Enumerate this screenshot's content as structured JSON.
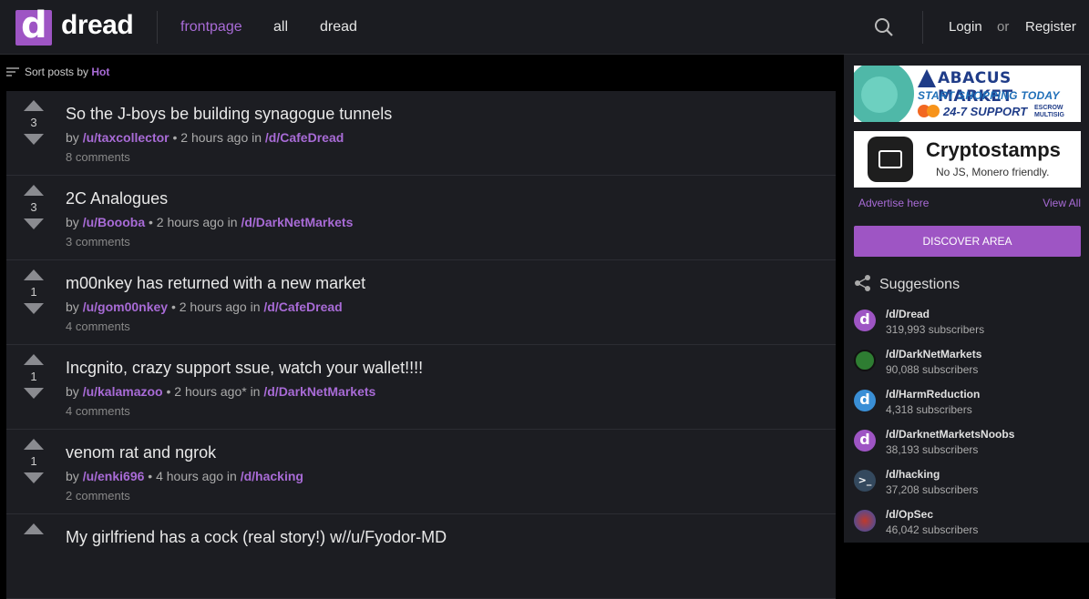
{
  "header": {
    "logo_letter": "d",
    "brand": "dread",
    "nav": [
      "frontpage",
      "all",
      "dread"
    ],
    "login": "Login",
    "or": "or",
    "register": "Register"
  },
  "sort": {
    "prefix": "Sort posts by",
    "value": "Hot"
  },
  "posts": [
    {
      "score": "3",
      "title": "So the J-boys be building synagogue tunnels",
      "by": "by",
      "author": "/u/taxcollector",
      "time": " • 2 hours ago in ",
      "sub": "/d/CafeDread",
      "comments": "8 comments"
    },
    {
      "score": "3",
      "title": "2C Analogues",
      "by": "by",
      "author": "/u/Boooba",
      "time": " • 2 hours ago in ",
      "sub": "/d/DarkNetMarkets",
      "comments": "3 comments"
    },
    {
      "score": "1",
      "title": "m00nkey has returned with a new market",
      "by": "by",
      "author": "/u/gom00nkey",
      "time": " • 2 hours ago in ",
      "sub": "/d/CafeDread",
      "comments": "4 comments"
    },
    {
      "score": "1",
      "title": "Incgnito, crazy support ssue, watch your wallet!!!!",
      "by": "by",
      "author": "/u/kalamazoo",
      "time": " • 2 hours ago* in ",
      "sub": "/d/DarkNetMarkets",
      "comments": "4 comments"
    },
    {
      "score": "1",
      "title": "venom rat and ngrok",
      "by": "by",
      "author": "/u/enki696",
      "time": " • 4 hours ago in ",
      "sub": "/d/hacking",
      "comments": "2 comments"
    },
    {
      "score": "",
      "title": "My girlfriend has a cock (real story!) w//u/Fyodor-MD",
      "by": "",
      "author": "",
      "time": "",
      "sub": "",
      "comments": ""
    }
  ],
  "ads": {
    "abacus_title": "ABACUS MARKET",
    "abacus_line2": "START SHOPPING TODAY",
    "abacus_line3": "24-7 SUPPORT",
    "abacus_small": "ESCROW MULTISIG",
    "crypto_title": "Cryptostamps",
    "crypto_sub": "No JS, Monero friendly.",
    "advertise": "Advertise here",
    "view_all": "View All"
  },
  "discover": "DISCOVER AREA",
  "suggestions_title": "Suggestions",
  "suggestions": [
    {
      "name": "/d/Dread",
      "subs": "319,993 subscribers",
      "color": "#9e55c4",
      "glyph": "d"
    },
    {
      "name": "/d/DarkNetMarkets",
      "subs": "90,088 subscribers",
      "color": "#2e7d32",
      "glyph": ""
    },
    {
      "name": "/d/HarmReduction",
      "subs": "4,318 subscribers",
      "color": "#3a8fd6",
      "glyph": "d"
    },
    {
      "name": "/d/DarknetMarketsNoobs",
      "subs": "38,193 subscribers",
      "color": "#9e55c4",
      "glyph": "d"
    },
    {
      "name": "/d/hacking",
      "subs": "37,208 subscribers",
      "color": "#34495e",
      "glyph": ">_"
    },
    {
      "name": "/d/OpSec",
      "subs": "46,042 subscribers",
      "color": "#5d4a8a",
      "glyph": ""
    }
  ]
}
